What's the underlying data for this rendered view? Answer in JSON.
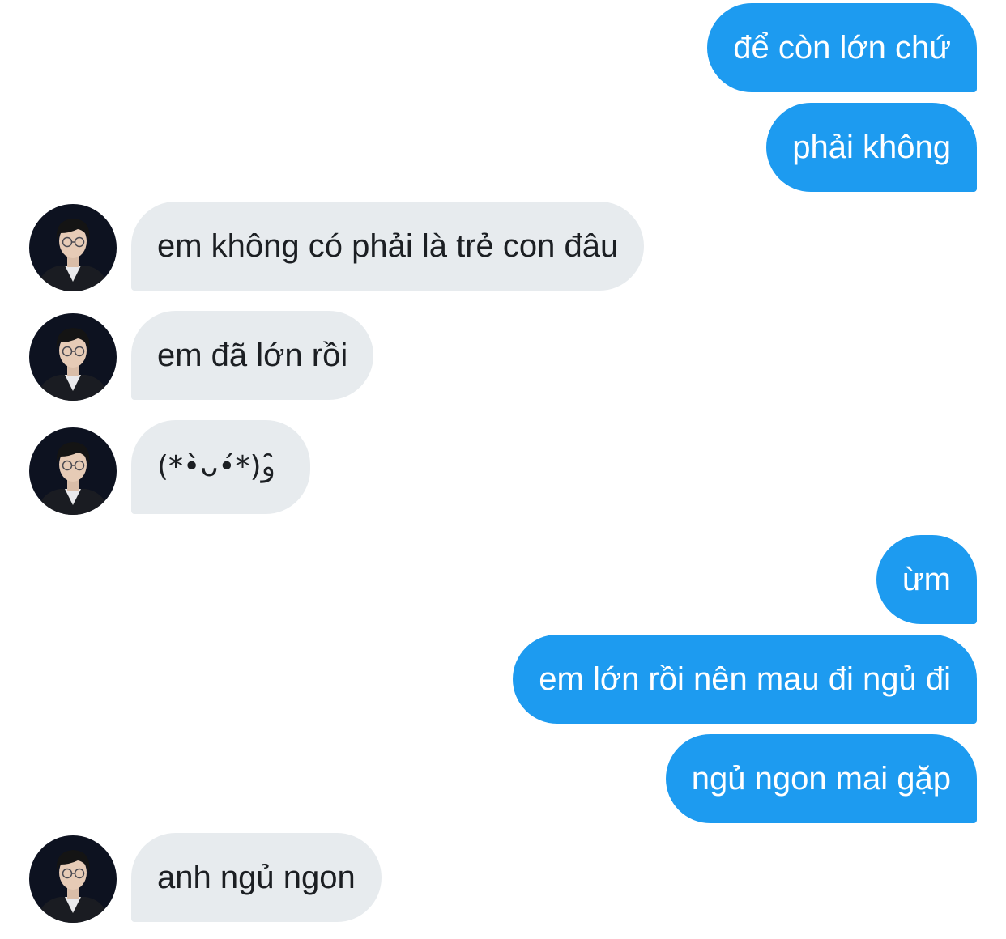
{
  "conversation": {
    "messages": [
      {
        "side": "out",
        "text": "để còn lớn chứ"
      },
      {
        "side": "out",
        "text": "phải không"
      },
      {
        "side": "in",
        "text": "em không có phải là trẻ con đâu",
        "avatar": "user-avatar"
      },
      {
        "side": "in",
        "text": "em đã lớn rồi",
        "avatar": "user-avatar"
      },
      {
        "side": "in",
        "text": "(*•̀ᴗ•́*)و ̑̑",
        "avatar": "user-avatar"
      },
      {
        "side": "out",
        "text": "ừm"
      },
      {
        "side": "out",
        "text": "em lớn rồi nên mau đi ngủ đi"
      },
      {
        "side": "out",
        "text": "ngủ ngon mai gặp"
      },
      {
        "side": "in",
        "text": "anh ngủ ngon",
        "avatar": "user-avatar"
      }
    ]
  },
  "colors": {
    "outgoing_bubble": "#1d9bf0",
    "incoming_bubble": "#e7ebee",
    "outgoing_text": "#ffffff",
    "incoming_text": "#1c1f23"
  }
}
